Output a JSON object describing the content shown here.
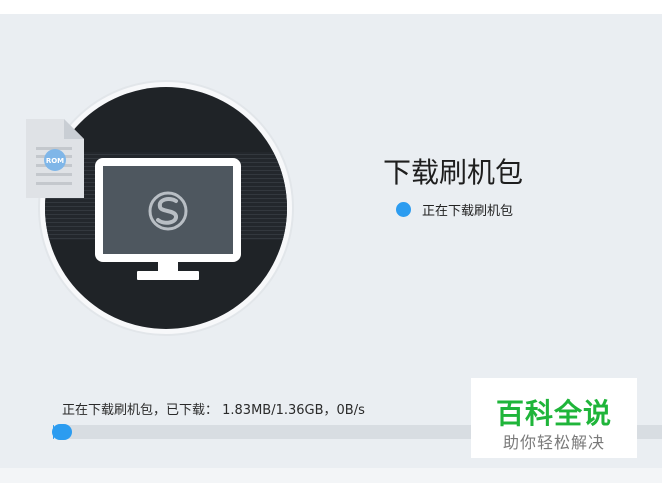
{
  "header": {
    "title": "下载刷机包"
  },
  "status": {
    "text": "正在下载刷机包",
    "dot_color": "#2c9cf0"
  },
  "illustration": {
    "monitor_icon": "monitor-icon",
    "brand_logo": "s-logo-icon",
    "rom_file_icon": "rom-file-icon",
    "rom_badge_text": "ROM"
  },
  "progress": {
    "label": "正在下载刷机包，已下载： 1.83MB/1.36GB，0B/s",
    "fraction": 0.0013,
    "color": "#2c9cf0"
  },
  "watermark": {
    "title": "百科全说",
    "subtitle": "助你轻松解决",
    "title_color": "#1fb53a"
  }
}
